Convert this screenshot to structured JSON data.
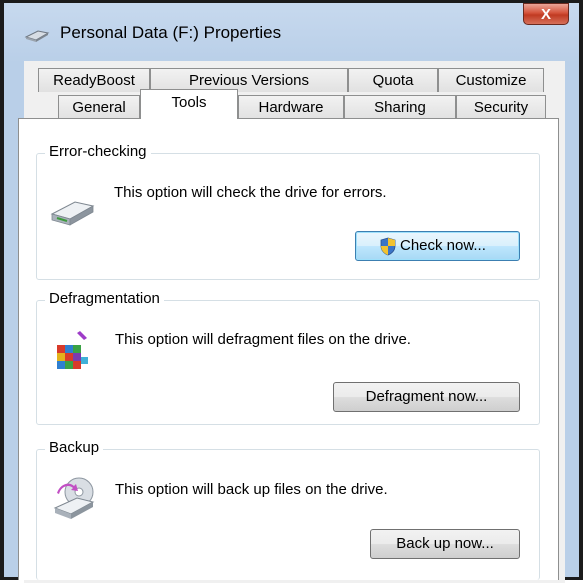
{
  "window": {
    "title": "Personal Data (F:) Properties",
    "close_label": "X"
  },
  "tabs_back": [
    "ReadyBoost",
    "Previous Versions",
    "Quota",
    "Customize"
  ],
  "tabs_front": [
    "General",
    "Tools",
    "Hardware",
    "Sharing",
    "Security"
  ],
  "active_tab": "Tools",
  "groups": {
    "error_checking": {
      "title": "Error-checking",
      "description": "This option will check the drive for errors.",
      "button": "Check now..."
    },
    "defrag": {
      "title": "Defragmentation",
      "description": "This option will defragment files on the drive.",
      "button": "Defragment now..."
    },
    "backup": {
      "title": "Backup",
      "description": "This option will back up files on the drive.",
      "button": "Back up now..."
    }
  },
  "icons": {
    "title": "drive-icon",
    "error_checking": "hard-drive-icon",
    "check_button": "uac-shield-icon",
    "defrag": "defragment-icon",
    "backup": "backup-disc-icon"
  }
}
